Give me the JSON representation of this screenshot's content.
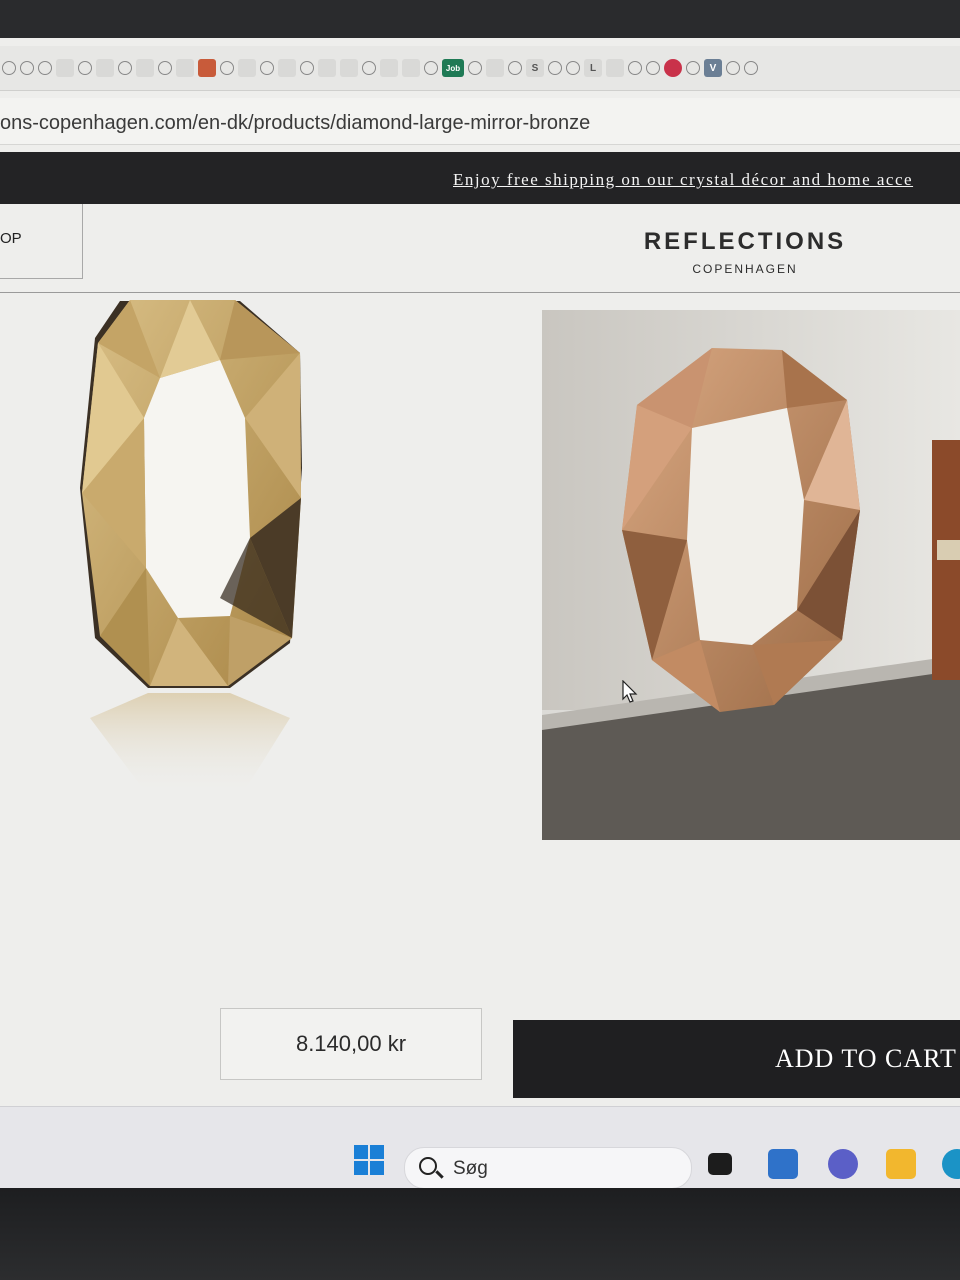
{
  "browser": {
    "url": "ons-copenhagen.com/en-dk/products/diamond-large-mirror-bronze",
    "bookmark_icons": [
      "search-icon",
      "search-icon",
      "search-icon",
      "bookmark-icon",
      "search-icon",
      "bookmark-icon",
      "search-icon",
      "grid-icon",
      "search-icon",
      "bookmark-icon",
      "calendar-icon",
      "search-icon",
      "bookmark-icon",
      "search-icon",
      "window-icon",
      "search-icon",
      "window-icon",
      "window-icon",
      "search-icon",
      "grid-icon",
      "bookmark-icon",
      "search-icon",
      "job-icon",
      "search-icon",
      "bookmark-icon",
      "search-icon",
      "s-icon",
      "search-icon",
      "search-icon",
      "l-icon",
      "window-icon",
      "search-icon",
      "search-icon",
      "heart-icon",
      "search-icon",
      "v-icon",
      "search-icon",
      "search-icon"
    ],
    "job_label": "Job",
    "s_label": "S",
    "l_label": "L",
    "v_label": "V"
  },
  "announcement": {
    "text": "Enjoy free shipping on our crystal décor and home acce"
  },
  "header": {
    "left_text": "OP",
    "brand": "REFLECTIONS",
    "brand_sub": "COPENHAGEN"
  },
  "product": {
    "price": "8.140,00 kr",
    "add_to_cart": "ADD TO CART"
  },
  "taskbar": {
    "search_label": "Søg"
  },
  "colors": {
    "announcement_bg": "#232325",
    "cart_bg": "#1f1f21",
    "mirror_bronze": "#c9a46a",
    "windows_blue": "#1a7fd6"
  }
}
